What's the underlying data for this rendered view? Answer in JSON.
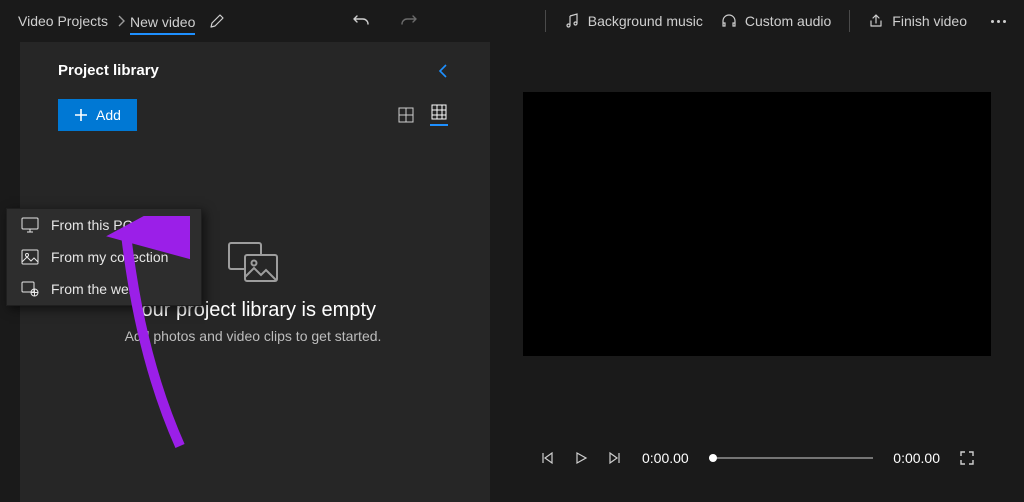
{
  "topbar": {
    "breadcrumb_root": "Video Projects",
    "title": "New video"
  },
  "top_actions": {
    "bg_music": "Background music",
    "custom_audio": "Custom audio",
    "finish": "Finish video"
  },
  "sidebar": {
    "title": "Project library",
    "add_label": "Add"
  },
  "add_menu": {
    "items": [
      {
        "label": "From this PC"
      },
      {
        "label": "From my collection"
      },
      {
        "label": "From the web"
      }
    ]
  },
  "empty": {
    "title": "Your project library is empty",
    "subtitle": "Add photos and video clips to get started."
  },
  "player": {
    "elapsed": "0:00.00",
    "total": "0:00.00"
  }
}
